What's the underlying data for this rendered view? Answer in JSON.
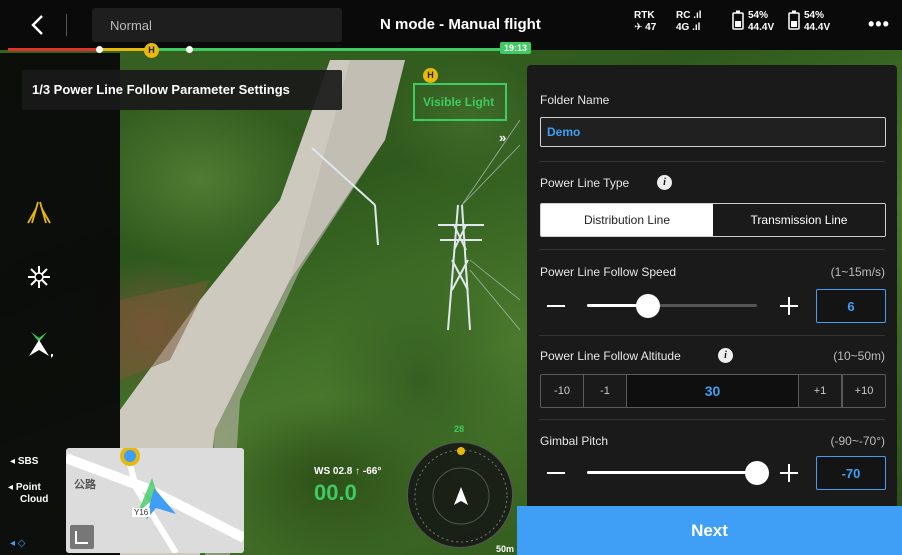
{
  "topbar": {
    "mode_label": "Normal",
    "flight_title": "N mode - Manual flight",
    "rtk_label": "RTK",
    "rtk_value": "47",
    "rc_label": "RC",
    "rc_network": "4G",
    "battery_left_pct": "54%",
    "battery_left_volt": "44.4V",
    "battery_right_pct": "54%",
    "battery_right_volt": "44.4V",
    "more_label": "•••",
    "time_tag": "19:13"
  },
  "route_markers": {
    "home": "H"
  },
  "title_bar": {
    "text": "1/3 Power Line Follow Parameter Settings"
  },
  "camera": {
    "visible_light": "Visible Light"
  },
  "left_panel": {
    "sbs": "SBS",
    "point_cloud_1": "Point",
    "point_cloud_2": "Cloud"
  },
  "telemetry": {
    "ws": "WS 02.8 ↑ -66°",
    "speed": "00.0",
    "radar_label": "50m",
    "map_road": "Y16",
    "map_text": "公路",
    "height_tag": "28"
  },
  "settings": {
    "folder_name_label": "Folder Name",
    "folder_name_value": "Demo",
    "power_line_type_label": "Power Line Type",
    "type_options": [
      "Distribution Line",
      "Transmission Line"
    ],
    "selected_type_index": 0,
    "speed": {
      "label": "Power Line Follow Speed",
      "range": "(1~15m/s)",
      "value": "6",
      "min": 1,
      "max": 15
    },
    "altitude": {
      "label": "Power Line Follow Altitude",
      "range": "(10~50m)",
      "value": "30",
      "buttons": [
        "-10",
        "-1",
        "+1",
        "+10"
      ]
    },
    "gimbal": {
      "label": "Gimbal Pitch",
      "range": "(-90~-70°)",
      "value": "-70",
      "min": -90,
      "max": -70
    }
  },
  "next_button": "Next",
  "colors": {
    "accent": "#3f9ef5",
    "route_green": "#3ecb61",
    "warning": "#e8b80a",
    "danger": "#e0322a"
  }
}
